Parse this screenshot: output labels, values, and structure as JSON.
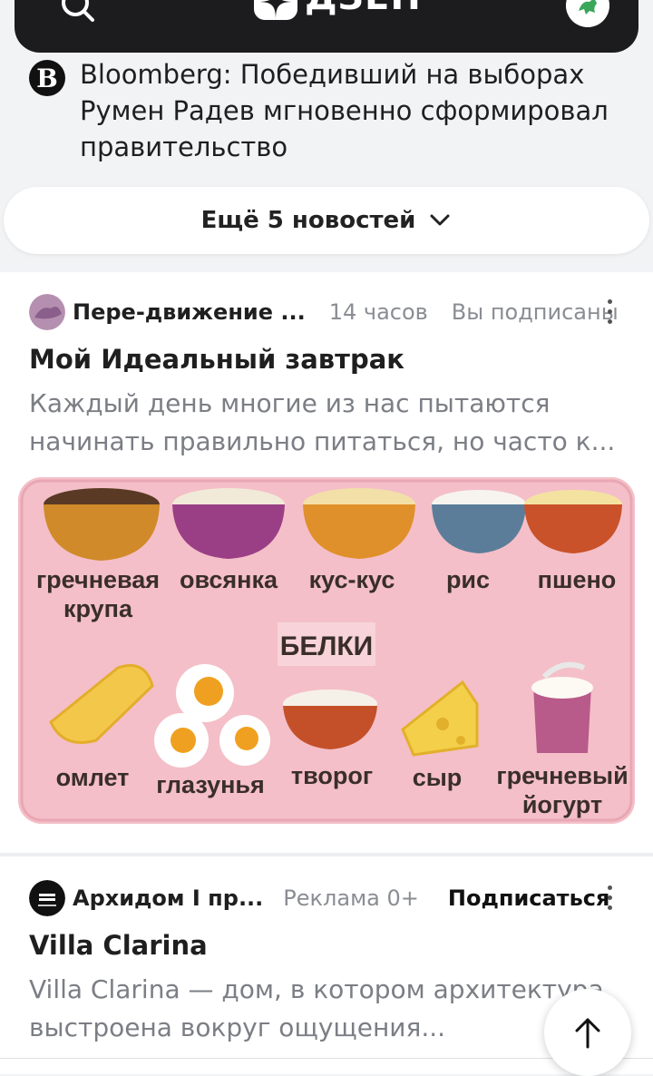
{
  "app": {
    "logo_text": "ДЗЕН"
  },
  "news": {
    "source_letter": "B",
    "headline": "Bloomberg: Победивший на выборах Румен Радев мгновенно сформировал правительство"
  },
  "more_news": {
    "label": "Ещё 5 новостей"
  },
  "post1": {
    "channel": "Пере-движение ...",
    "time": "14 часов",
    "status": "Вы подписаны",
    "title": "Мой Идеальный завтрак",
    "description": "Каждый день многие из нас пытаются начинать правильно питаться, но часто к...",
    "image": {
      "grains": [
        "гречневая крупа",
        "овсянка",
        "кус-кус",
        "рис",
        "пшено"
      ],
      "section_label": "БЕЛКИ",
      "proteins": [
        "омлет",
        "глазунья",
        "творог",
        "сыр",
        "гречневый йогурт"
      ]
    }
  },
  "post2": {
    "channel": "Архидом I пр...",
    "ad_label": "Реклама 0+",
    "subscribe": "Подписаться",
    "title": "Villa Clarina",
    "description": "Villa Clarina — дом, в котором архитектура выстроена вокруг ощущения..."
  },
  "icons": {
    "search": "search-icon",
    "user": "user-avatar-icon",
    "chevron": "chevron-down-icon",
    "menu": "more-vertical-icon",
    "up": "arrow-up-icon"
  }
}
